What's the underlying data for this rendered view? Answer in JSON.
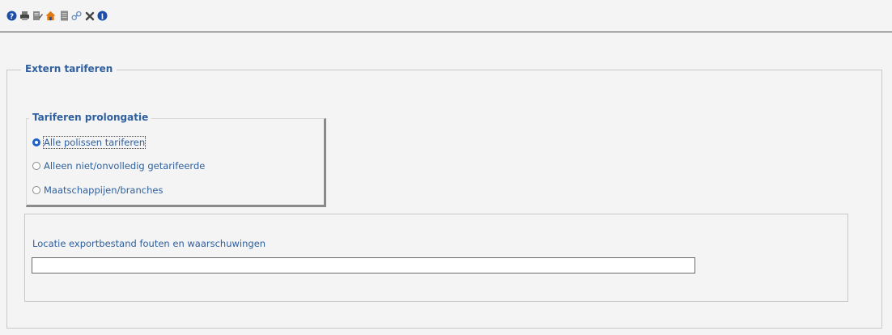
{
  "toolbar": {
    "icons": [
      {
        "name": "help-icon"
      },
      {
        "name": "print-icon"
      },
      {
        "name": "document-edit-icon"
      },
      {
        "name": "home-icon"
      },
      {
        "name": "document-icon"
      },
      {
        "name": "link-icon"
      },
      {
        "name": "close-icon"
      },
      {
        "name": "info-icon"
      }
    ]
  },
  "extern_tariferen": {
    "legend": "Extern tariferen"
  },
  "tariferen_prolongatie": {
    "legend": "Tariferen prolongatie",
    "options": [
      {
        "label": "Alle polissen tariferen",
        "checked": true
      },
      {
        "label": "Alleen niet/onvolledig getarifeerde",
        "checked": false
      },
      {
        "label": "Maatschappijen/branches",
        "checked": false
      }
    ]
  },
  "locatie": {
    "label": "Locatie exportbestand fouten en waarschuwingen",
    "value": ""
  },
  "colors": {
    "label_blue": "#2e5f9e",
    "radio_selected": "#1d63c7",
    "background": "#f4f4f4"
  }
}
